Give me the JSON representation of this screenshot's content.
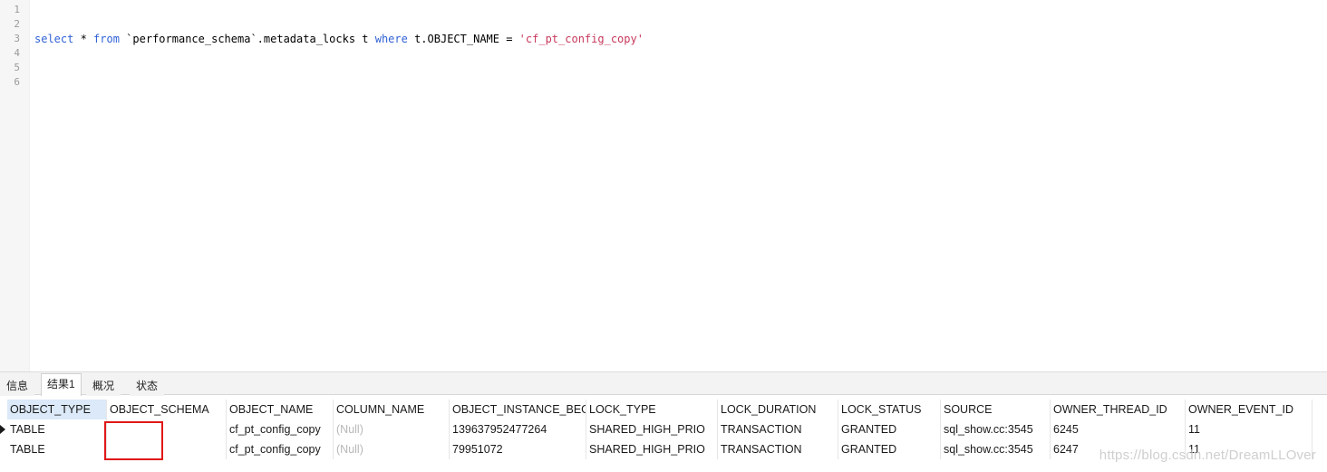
{
  "editor": {
    "line_numbers": [
      "1",
      "2",
      "3",
      "4",
      "5",
      "6"
    ],
    "query": {
      "kw_select": "select",
      "star": " * ",
      "kw_from": "from",
      "table": " `performance_schema`.metadata_locks t ",
      "kw_where": "where",
      "condition": " t.OBJECT_NAME = ",
      "literal": "'cf_pt_config_copy'"
    }
  },
  "tabs": [
    {
      "label": "信息"
    },
    {
      "label": "结果1"
    },
    {
      "label": "概况"
    },
    {
      "label": "状态"
    }
  ],
  "grid": {
    "columns": [
      "OBJECT_TYPE",
      "OBJECT_SCHEMA",
      "OBJECT_NAME",
      "COLUMN_NAME",
      "OBJECT_INSTANCE_BEGIN",
      "LOCK_TYPE",
      "LOCK_DURATION",
      "LOCK_STATUS",
      "SOURCE",
      "OWNER_THREAD_ID",
      "OWNER_EVENT_ID"
    ],
    "rows": [
      [
        "TABLE",
        "",
        "cf_pt_config_copy",
        "(Null)",
        "139637952477264",
        "SHARED_HIGH_PRIO",
        "TRANSACTION",
        "GRANTED",
        "sql_show.cc:3545",
        "6245",
        "11"
      ],
      [
        "TABLE",
        "",
        "cf_pt_config_copy",
        "(Null)",
        "79951072",
        "SHARED_HIGH_PRIO",
        "TRANSACTION",
        "GRANTED",
        "sql_show.cc:3545",
        "6247",
        "11"
      ]
    ]
  },
  "watermark": "https://blog.csdn.net/DreamLLOver",
  "colors": {
    "keyword": "#3062d6",
    "string_literal": "#c8385c",
    "null_text": "#b8b8b8",
    "header_selected": "#dbe9f8",
    "annotation_box": "#e01818"
  }
}
